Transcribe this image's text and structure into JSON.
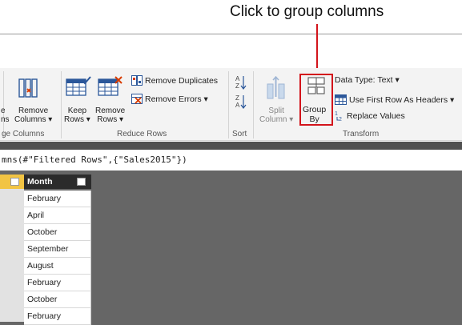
{
  "callout": {
    "text": "Click to group columns"
  },
  "ribbon": {
    "manage_columns": {
      "remove_columns": [
        "Remove",
        "Columns ▾"
      ],
      "partial_left": [
        "e",
        "ns"
      ],
      "group_label": "ge Columns"
    },
    "reduce_rows": {
      "keep_rows": [
        "Keep",
        "Rows ▾"
      ],
      "remove_rows": [
        "Remove",
        "Rows ▾"
      ],
      "remove_duplicates": "Remove Duplicates",
      "remove_errors": "Remove Errors ▾",
      "group_label": "Reduce Rows"
    },
    "sort": {
      "group_label": "Sort"
    },
    "transform": {
      "split_column": [
        "Split",
        "Column ▾"
      ],
      "group_by": [
        "Group",
        "By"
      ],
      "data_type": "Data Type: Text ▾",
      "use_first_row": "Use First Row As Headers ▾",
      "replace_values": "Replace Values",
      "group_label": "Transform"
    }
  },
  "formula_bar": {
    "text": "mns(#\"Filtered Rows\",{\"Sales2015\"})"
  },
  "table": {
    "column_header": "Month",
    "rows": [
      "February",
      "April",
      "October",
      "September",
      "August",
      "February",
      "October",
      "February"
    ]
  },
  "colors": {
    "accent": "#d3141b",
    "header_bg": "#2b2b2b",
    "selected_col": "#f2c443"
  }
}
